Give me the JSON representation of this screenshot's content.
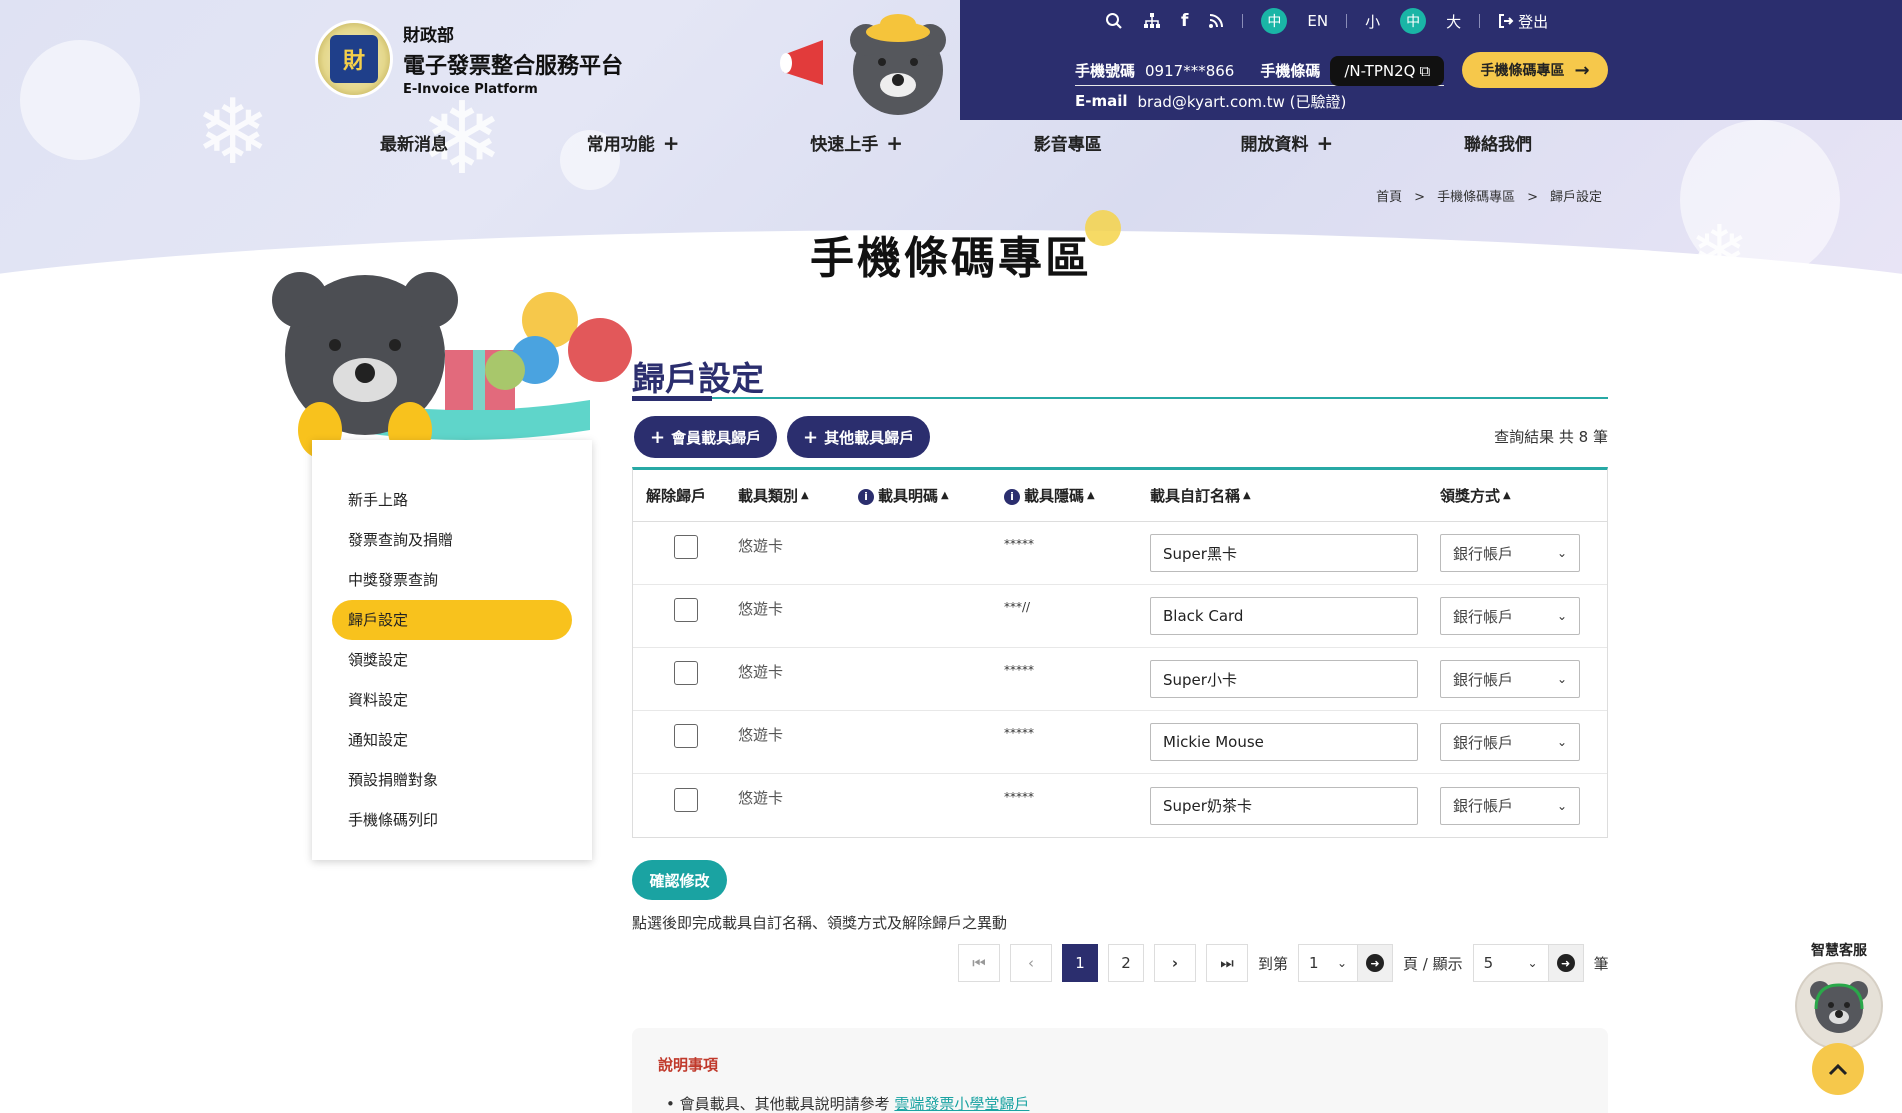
{
  "header": {
    "ministry": "財政部",
    "platform": "電子發票整合服務平台",
    "platform_en": "E-Invoice Platform",
    "lang_zh": "中",
    "lang_en": "EN",
    "font_small": "小",
    "font_mid": "中",
    "font_large": "大",
    "logout": "登出",
    "phone_label": "手機號碼",
    "phone_value": "0917***866",
    "barcode_label": "手機條碼",
    "barcode_value": "/N-TPN2Q",
    "email_label": "E-mail",
    "email_value": "brad@kyart.com.tw (已驗證)",
    "zone_button": "手機條碼專區"
  },
  "nav": [
    {
      "label": "最新消息",
      "plus": ""
    },
    {
      "label": "常用功能",
      "plus": "+"
    },
    {
      "label": "快速上手",
      "plus": "+"
    },
    {
      "label": "影音專區",
      "plus": ""
    },
    {
      "label": "開放資料",
      "plus": "+"
    },
    {
      "label": "聯絡我們",
      "plus": ""
    }
  ],
  "breadcrumb": [
    "首頁",
    ">",
    "手機條碼專區",
    ">",
    "歸戶設定"
  ],
  "page_title": "手機條碼專區",
  "sidebar": [
    {
      "label": "新手上路",
      "active": false
    },
    {
      "label": "發票查詢及捐贈",
      "active": false
    },
    {
      "label": "中獎發票查詢",
      "active": false
    },
    {
      "label": "歸戶設定",
      "active": true
    },
    {
      "label": "領獎設定",
      "active": false
    },
    {
      "label": "資料設定",
      "active": false
    },
    {
      "label": "通知設定",
      "active": false
    },
    {
      "label": "預設捐贈對象",
      "active": false
    },
    {
      "label": "手機條碼列印",
      "active": false
    }
  ],
  "section": {
    "title": "歸戶設定",
    "btn_member": "會員載具歸戶",
    "btn_other": "其他載具歸戶",
    "result": "查詢結果 共 8 筆"
  },
  "table": {
    "headers": [
      "解除歸戶",
      "載具類別",
      "載具明碼",
      "載具隱碼",
      "載具自訂名稱",
      "領獎方式"
    ],
    "rows": [
      {
        "type": "悠遊卡",
        "mask": "*****",
        "name": "Super黑卡",
        "method": "銀行帳戶"
      },
      {
        "type": "悠遊卡",
        "mask": "***//",
        "name": "Black Card",
        "method": "銀行帳戶"
      },
      {
        "type": "悠遊卡",
        "mask": "*****",
        "name": "Super小卡",
        "method": "銀行帳戶"
      },
      {
        "type": "悠遊卡",
        "mask": "*****",
        "name": "Mickie Mouse",
        "method": "銀行帳戶"
      },
      {
        "type": "悠遊卡",
        "mask": "*****",
        "name": "Super奶茶卡",
        "method": "銀行帳戶"
      }
    ]
  },
  "confirm": "確認修改",
  "hint": "點選後即完成載具自訂名稱、領獎方式及解除歸戶之異動",
  "pager": {
    "pages": [
      "1",
      "2"
    ],
    "current": "1",
    "goto_label": "到第",
    "page_select": "1",
    "page_unit": "頁 / 顯示",
    "size_select": "5",
    "size_unit": "筆"
  },
  "notes": {
    "title": "說明事項",
    "text": "會員載具、其他載具說明請參考",
    "link": "雲端發票小學堂歸戶"
  },
  "bot_label": "智慧客服",
  "colors": {
    "navy": "#2b2e6e",
    "teal": "#1aa3a2",
    "yellow": "#f8c21d"
  }
}
